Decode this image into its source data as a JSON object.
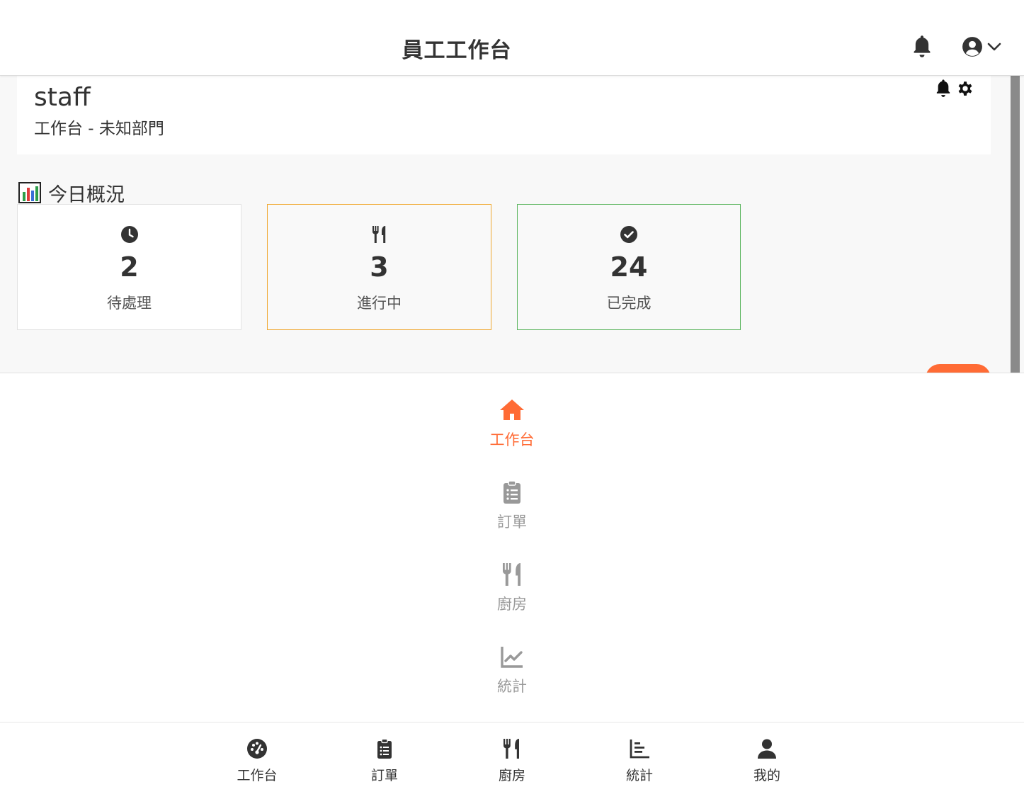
{
  "header": {
    "title": "員工工作台",
    "icons": [
      "bell-icon",
      "user-circle-icon",
      "chevron-down-icon"
    ]
  },
  "profile": {
    "username": "staff",
    "subtitle": "工作台 - 未知部門",
    "icons": [
      "bell-icon",
      "gear-icon"
    ]
  },
  "overview": {
    "title": "今日概況",
    "icon": "bar-chart-icon",
    "stats": [
      {
        "icon": "clock-icon",
        "value": "2",
        "label": "待處理",
        "border": "#e2e2e2"
      },
      {
        "icon": "utensils-icon",
        "value": "3",
        "label": "進行中",
        "border": "#f0a830"
      },
      {
        "icon": "check-circle-icon",
        "value": "24",
        "label": "已完成",
        "border": "#5bb55e"
      }
    ]
  },
  "side_menu": {
    "items": [
      {
        "label": "工作台",
        "icon": "home-icon",
        "active": true
      },
      {
        "label": "訂單",
        "icon": "clipboard-list-icon",
        "active": false
      },
      {
        "label": "廚房",
        "icon": "utensils-icon",
        "active": false
      },
      {
        "label": "統計",
        "icon": "line-chart-icon",
        "active": false
      }
    ]
  },
  "tab_bar": {
    "items": [
      {
        "label": "工作台",
        "icon": "dashboard-icon"
      },
      {
        "label": "訂單",
        "icon": "clipboard-list-icon"
      },
      {
        "label": "廚房",
        "icon": "utensils-icon"
      },
      {
        "label": "統計",
        "icon": "bar-chart-icon"
      },
      {
        "label": "我的",
        "icon": "user-icon"
      }
    ]
  },
  "colors": {
    "accent": "#ff6b35",
    "inactive": "#999999",
    "text": "#333333",
    "pending_border": "#e2e2e2",
    "progress_border": "#f0a830",
    "done_border": "#5bb55e"
  }
}
